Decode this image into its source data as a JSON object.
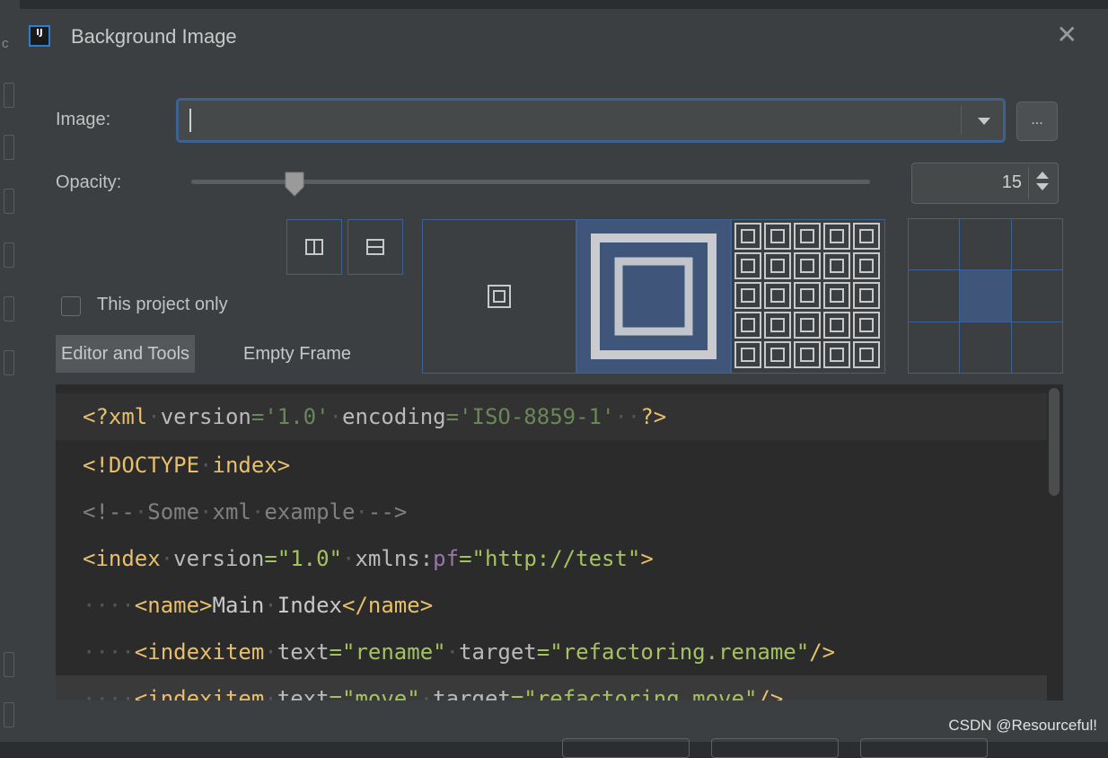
{
  "window": {
    "title": "Background Image",
    "app_icon_text": "IJ"
  },
  "image_field": {
    "label": "Image:",
    "value": "",
    "browse_label": "..."
  },
  "opacity": {
    "label": "Opacity:",
    "value": "15",
    "slider_fraction": 0.15
  },
  "this_project_only": {
    "label": "This project only",
    "checked": false
  },
  "tabs": [
    {
      "label": "Editor and Tools",
      "active": true
    },
    {
      "label": "Empty Frame",
      "active": false
    }
  ],
  "fill_options": [
    "center",
    "scale",
    "tile"
  ],
  "selected_fill": "scale",
  "anchor": {
    "selected": "center"
  },
  "colors": {
    "accent": "#3d6190",
    "selected_fill": "#40557a",
    "bg": "#3c3f41"
  },
  "code_lines": [
    "<?xml version='1.0' encoding='ISO-8859-1'  ?>",
    "<!DOCTYPE index>",
    "<!-- Some xml example -->",
    "<index version=\"1.0\" xmlns:pf=\"http://test\">",
    "  <name>Main Index</name>",
    "  <indexitem text=\"rename\" target=\"refactoring.rename\"/>",
    "  <indexitem text=\"move\" target=\"refactoring.move\"/>"
  ],
  "watermark": "CSDN @Resourceful!"
}
